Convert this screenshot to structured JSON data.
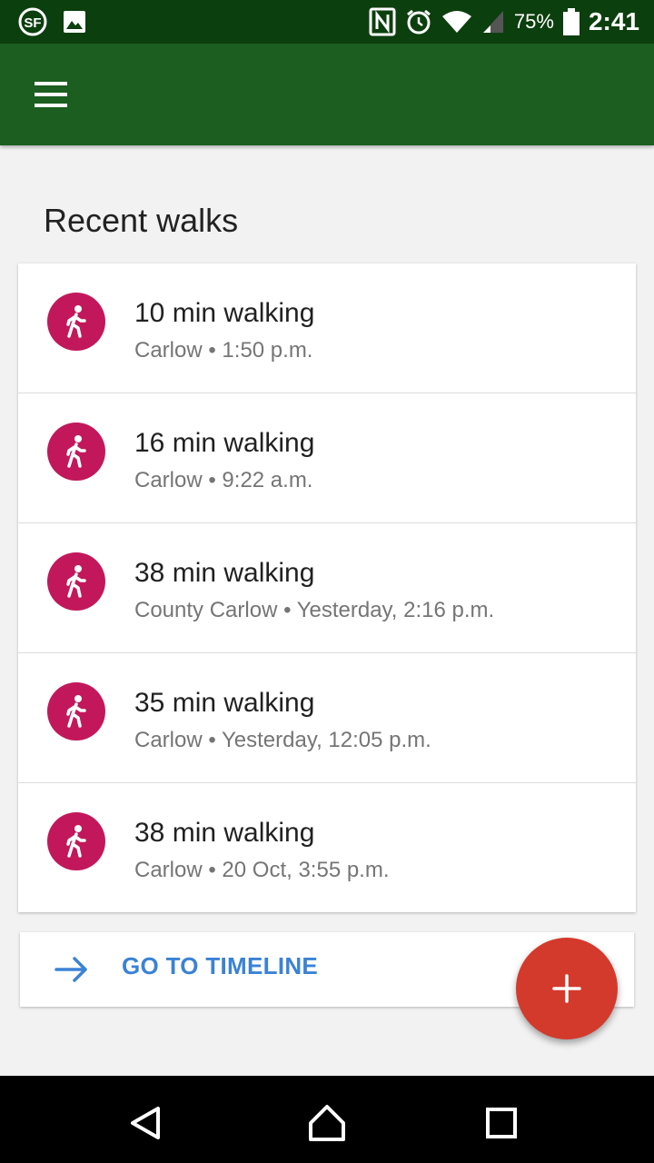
{
  "status_bar": {
    "battery_percent": "75%",
    "time": "2:41",
    "left_icons": [
      "sf-notification-icon",
      "image-notification-icon"
    ],
    "right_icons": [
      "nfc-icon",
      "alarm-icon",
      "wifi-icon",
      "signal-icon",
      "battery-icon"
    ]
  },
  "app_bar": {
    "menu_icon": "hamburger-menu-icon",
    "color": "#1b5e20"
  },
  "section": {
    "title": "Recent walks"
  },
  "walks": [
    {
      "title": "10 min walking",
      "subtitle": "Carlow • 1:50 p.m."
    },
    {
      "title": "16 min walking",
      "subtitle": "Carlow • 9:22 a.m."
    },
    {
      "title": "38 min walking",
      "subtitle": "County Carlow • Yesterday, 2:16 p.m."
    },
    {
      "title": "35 min walking",
      "subtitle": "Carlow • Yesterday, 12:05 p.m."
    },
    {
      "title": "38 min walking",
      "subtitle": "Carlow • 20 Oct, 3:55 p.m."
    }
  ],
  "walk_icon": {
    "name": "walking-icon",
    "color": "#c2185b"
  },
  "timeline": {
    "label": "GO TO TIMELINE",
    "icon": "arrow-right-icon",
    "color": "#3b82d6"
  },
  "fab": {
    "icon": "plus-icon",
    "color": "#d33a2c"
  },
  "nav_bar": {
    "buttons": [
      "back-icon",
      "home-icon",
      "recents-icon"
    ]
  }
}
